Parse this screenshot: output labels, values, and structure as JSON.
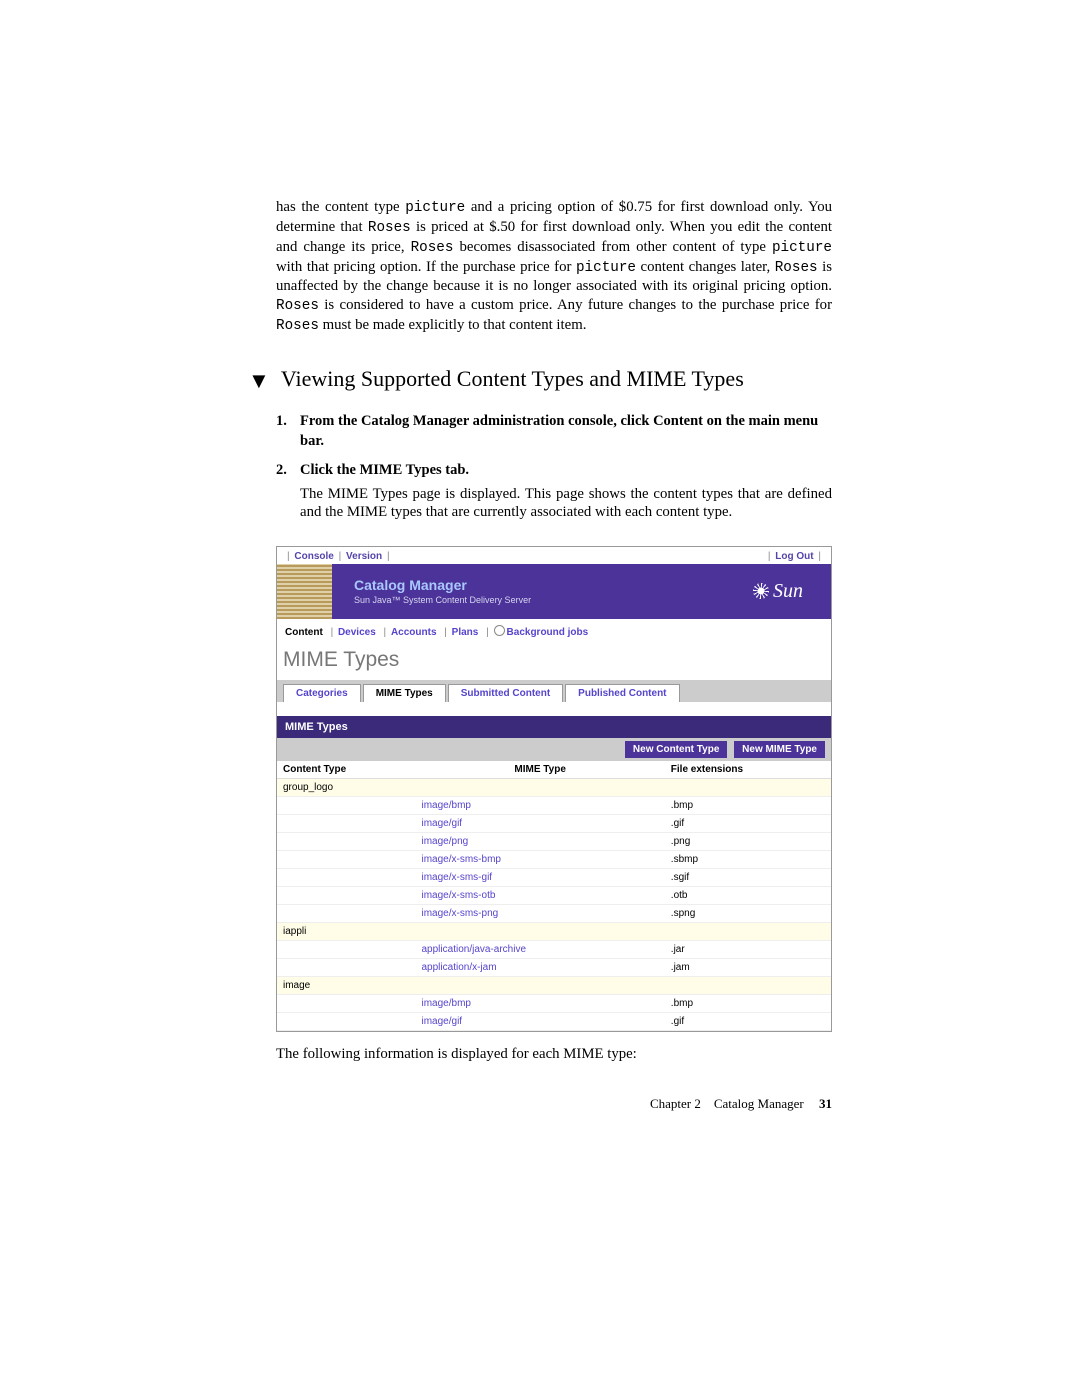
{
  "intro": {
    "segments": [
      {
        "t": "has the content type "
      },
      {
        "t": "picture",
        "mono": true
      },
      {
        "t": " and a pricing option of $0.75 for first download only. You determine that "
      },
      {
        "t": "Roses",
        "mono": true
      },
      {
        "t": " is priced at $.50 for first download only. When you edit the content and change its price, "
      },
      {
        "t": "Roses",
        "mono": true
      },
      {
        "t": " becomes disassociated from other content of type "
      },
      {
        "t": "picture",
        "mono": true
      },
      {
        "t": " with that pricing option. If the purchase price for "
      },
      {
        "t": "picture",
        "mono": true
      },
      {
        "t": " content changes later, "
      },
      {
        "t": "Roses",
        "mono": true
      },
      {
        "t": " is unaffected by the change because it is no longer associated with its original pricing option. "
      },
      {
        "t": "Roses",
        "mono": true
      },
      {
        "t": " is considered to have a custom price. Any future changes to the purchase price for "
      },
      {
        "t": "Roses",
        "mono": true
      },
      {
        "t": " must be made explicitly to that content item."
      }
    ]
  },
  "section_heading": "Viewing Supported Content Types and MIME Types",
  "steps": [
    {
      "num": "1.",
      "text": "From the Catalog Manager administration console, click Content on the main menu bar."
    },
    {
      "num": "2.",
      "text": "Click the MIME Types tab.",
      "desc": "The MIME Types page is displayed. This page shows the content types that are defined and the MIME types that are currently associated with each content type."
    }
  ],
  "screenshot": {
    "top": {
      "console": "Console",
      "version": "Version",
      "logout": "Log Out"
    },
    "brand": {
      "title": "Catalog Manager",
      "sub": "Sun Java™ System Content Delivery Server",
      "sun": "Sun"
    },
    "mainnav": {
      "content": "Content",
      "devices": "Devices",
      "accounts": "Accounts",
      "plans": "Plans",
      "bg": "Background jobs"
    },
    "page_title": "MIME Types",
    "tabs": {
      "categories": "Categories",
      "mime": "MIME Types",
      "submitted": "Submitted Content",
      "published": "Published Content"
    },
    "panel_title": "MIME Types",
    "buttons": {
      "new_ct": "New Content Type",
      "new_mime": "New MIME Type"
    },
    "columns": {
      "ct": "Content Type",
      "mime": "MIME Type",
      "ext": "File extensions"
    },
    "rows": [
      {
        "group": "group_logo"
      },
      {
        "mime": "image/bmp",
        "ext": ".bmp"
      },
      {
        "mime": "image/gif",
        "ext": ".gif"
      },
      {
        "mime": "image/png",
        "ext": ".png"
      },
      {
        "mime": "image/x-sms-bmp",
        "ext": ".sbmp"
      },
      {
        "mime": "image/x-sms-gif",
        "ext": ".sgif"
      },
      {
        "mime": "image/x-sms-otb",
        "ext": ".otb"
      },
      {
        "mime": "image/x-sms-png",
        "ext": ".spng"
      },
      {
        "group": "iappli"
      },
      {
        "mime": "application/java-archive",
        "ext": ".jar"
      },
      {
        "mime": "application/x-jam",
        "ext": ".jam"
      },
      {
        "group": "image"
      },
      {
        "mime": "image/bmp",
        "ext": ".bmp"
      },
      {
        "mime": "image/gif",
        "ext": ".gif"
      }
    ]
  },
  "after_text": "The following information is displayed for each MIME type:",
  "footer": {
    "chapter": "Chapter 2",
    "title": "Catalog Manager",
    "page": "31"
  }
}
